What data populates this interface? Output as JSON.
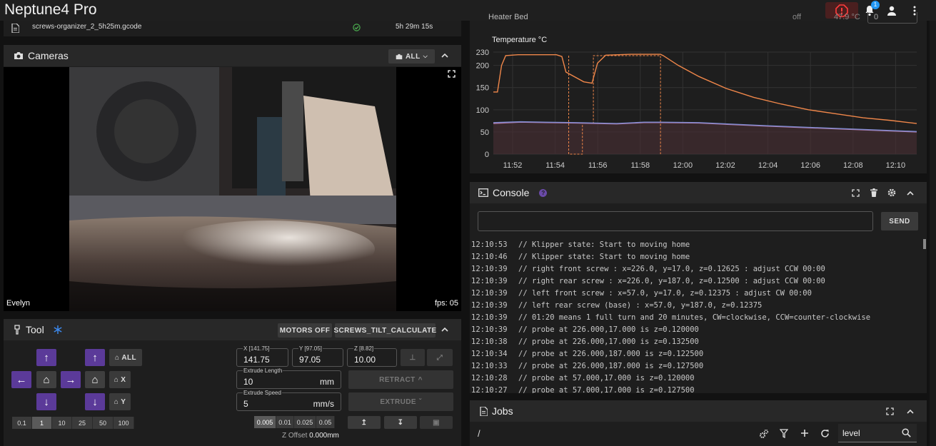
{
  "app": {
    "title": "Neptune4 Pro",
    "notification_count": "1"
  },
  "file": {
    "name": "screws-organizer_2_5h25m.gcode",
    "duration": "5h 29m 15s"
  },
  "cameras": {
    "title": "Cameras",
    "filter_label": "ALL",
    "camera_name": "Evelyn",
    "fps": "fps: 05"
  },
  "tool": {
    "title": "Tool",
    "motors_off": "MOTORS OFF",
    "screws_tilt": "SCREWS_TILT_CALCULATE",
    "home_all": "ALL",
    "home_x": "X",
    "home_y": "Y",
    "jog_steps": [
      "0.1",
      "1",
      "10",
      "25",
      "50",
      "100"
    ],
    "jog_selected": "1",
    "x_label": "X [141.75]",
    "x_value": "141.75",
    "y_label": "Y [97.05]",
    "y_value": "97.05",
    "z_label": "Z [8.82]",
    "z_value": "10.00",
    "extrude_length_label": "Extrude Length",
    "extrude_length_value": "10",
    "extrude_length_unit": "mm",
    "extrude_speed_label": "Extrude Speed",
    "extrude_speed_value": "5",
    "extrude_speed_unit": "mm/s",
    "retract": "RETRACT",
    "extrude": "EXTRUDE",
    "z_steps": [
      "0.005",
      "0.01",
      "0.025",
      "0.05"
    ],
    "z_selected": "0.005",
    "z_offset_label": "Z Offset",
    "z_offset_value": "0.000mm"
  },
  "heater": {
    "name": "Heater Bed",
    "power": "off",
    "temp": "47.9 °C",
    "target": "0"
  },
  "chart_data": {
    "type": "line",
    "ylabel": "Temperature °C",
    "ylim": [
      0,
      230
    ],
    "yticks": [
      0,
      50,
      100,
      150,
      200,
      230
    ],
    "xticks": [
      "11:52",
      "11:54",
      "11:56",
      "11:58",
      "12:00",
      "12:02",
      "12:04",
      "12:06",
      "12:08",
      "12:10"
    ],
    "series": [
      {
        "color": "#f0874a",
        "values": [
          [
            0,
            140
          ],
          [
            3,
            140
          ],
          [
            6,
            200
          ],
          [
            9,
            222
          ],
          [
            18,
            224
          ],
          [
            46,
            224
          ],
          [
            50,
            220
          ],
          [
            53,
            185
          ],
          [
            66,
            163
          ],
          [
            72,
            160
          ],
          [
            76,
            205
          ],
          [
            82,
            223
          ],
          [
            100,
            225
          ],
          [
            122,
            225
          ],
          [
            124,
            222
          ],
          [
            135,
            200
          ],
          [
            150,
            175
          ],
          [
            170,
            148
          ],
          [
            190,
            128
          ],
          [
            210,
            113
          ],
          [
            230,
            100
          ],
          [
            250,
            91
          ],
          [
            270,
            82
          ],
          [
            290,
            76
          ],
          [
            309,
            69
          ]
        ]
      },
      {
        "color": "#f0874a",
        "dashed": true,
        "values": [
          [
            55,
            222
          ],
          [
            55,
            0
          ],
          [
            62,
            0
          ],
          [
            62,
            0
          ],
          [
            65,
            0
          ],
          [
            65,
            70
          ],
          [
            73,
            70
          ],
          [
            73,
            222
          ],
          [
            122,
            222
          ],
          [
            122,
            0
          ]
        ]
      },
      {
        "color": "#b57aa7",
        "values": [
          [
            0,
            69
          ],
          [
            20,
            72
          ],
          [
            60,
            70
          ],
          [
            90,
            68
          ],
          [
            110,
            71
          ],
          [
            122,
            71
          ],
          [
            150,
            70
          ],
          [
            200,
            63
          ],
          [
            250,
            57
          ],
          [
            309,
            50
          ]
        ]
      },
      {
        "color": "#7f8bd1",
        "values": [
          [
            0,
            71
          ],
          [
            20,
            73
          ],
          [
            60,
            71
          ],
          [
            90,
            69
          ],
          [
            110,
            72
          ],
          [
            122,
            72
          ],
          [
            150,
            71
          ],
          [
            200,
            64
          ],
          [
            250,
            58
          ],
          [
            309,
            51
          ]
        ]
      }
    ]
  },
  "console": {
    "title": "Console",
    "send": "SEND",
    "lines": [
      {
        "time": "12:10:53",
        "text": "// Klipper state: Start to moving home"
      },
      {
        "time": "12:10:46",
        "text": "// Klipper state: Start to moving home"
      },
      {
        "time": "12:10:39",
        "text": "// right front screw : x=226.0, y=17.0, z=0.12625 : adjust CCW 00:00"
      },
      {
        "time": "12:10:39",
        "text": "// right rear screw : x=226.0, y=187.0, z=0.12500 : adjust CCW 00:00"
      },
      {
        "time": "12:10:39",
        "text": "// left front screw : x=57.0, y=17.0, z=0.12375 : adjust CW 00:00"
      },
      {
        "time": "12:10:39",
        "text": "// left rear screw (base) : x=57.0, y=187.0, z=0.12375"
      },
      {
        "time": "12:10:39",
        "text": "// 01:20 means 1 full turn and 20 minutes, CW=clockwise, CCW=counter-clockwise"
      },
      {
        "time": "12:10:39",
        "text": "// probe at 226.000,17.000 is z=0.120000"
      },
      {
        "time": "12:10:38",
        "text": "// probe at 226.000,17.000 is z=0.132500"
      },
      {
        "time": "12:10:34",
        "text": "// probe at 226.000,187.000 is z=0.122500"
      },
      {
        "time": "12:10:33",
        "text": "// probe at 226.000,187.000 is z=0.127500"
      },
      {
        "time": "12:10:28",
        "text": "// probe at 57.000,17.000 is z=0.120000"
      },
      {
        "time": "12:10:27",
        "text": "// probe at 57.000,17.000 is z=0.127500"
      }
    ]
  },
  "jobs": {
    "title": "Jobs",
    "path": "/",
    "search_value": "level"
  }
}
